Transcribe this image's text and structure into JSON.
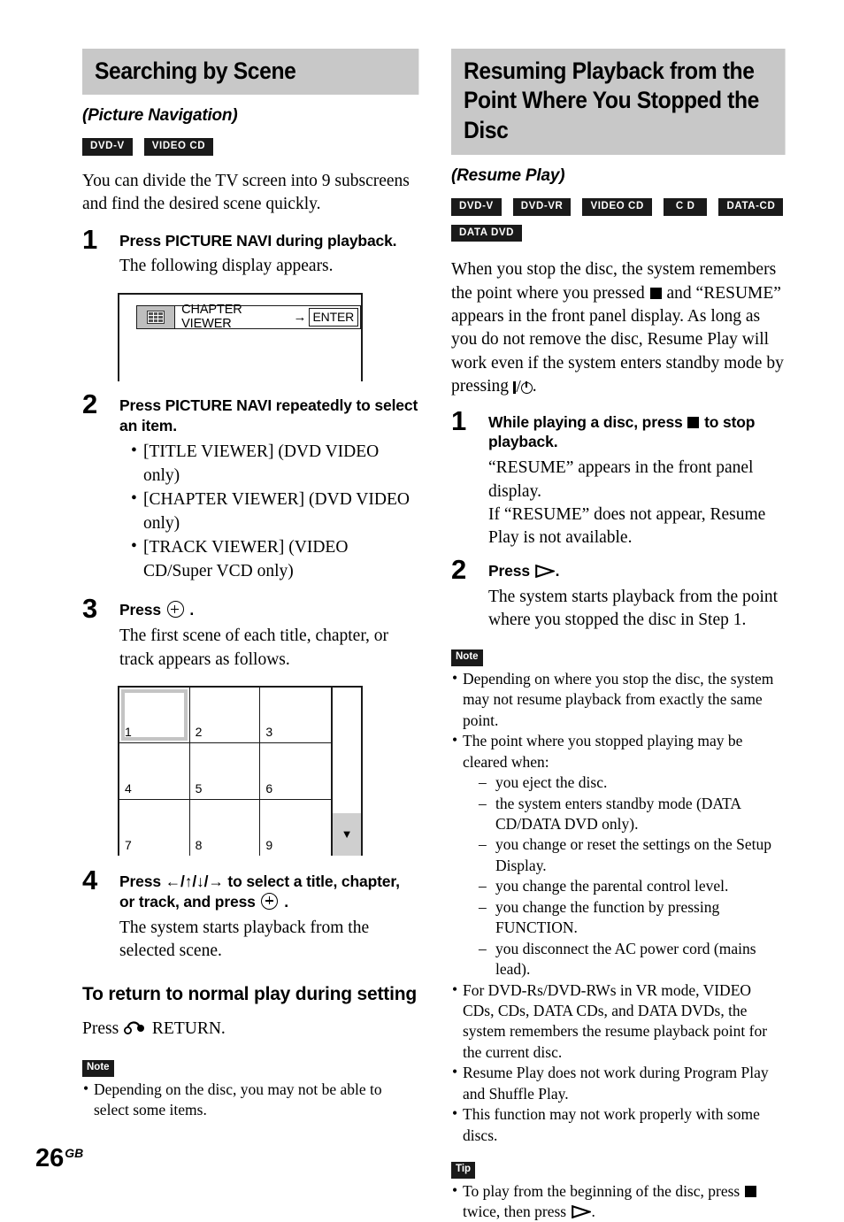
{
  "page": {
    "number": "26",
    "region_suffix": "GB"
  },
  "left_column": {
    "heading": "Searching by Scene",
    "subheading": "(Picture Navigation)",
    "badges": [
      "DVD-V",
      "VIDEO CD"
    ],
    "intro": "You can divide the TV screen into 9 subscreens and find the desired scene quickly.",
    "steps": [
      {
        "number": "1",
        "title": "Press PICTURE NAVI during playback.",
        "body": "The following display appears."
      },
      {
        "number": "2",
        "title": "Press PICTURE NAVI repeatedly to select an item.",
        "bullets": [
          "[TITLE VIEWER] (DVD VIDEO only)",
          "[CHAPTER VIEWER] (DVD VIDEO only)",
          "[TRACK VIEWER] (VIDEO CD/Super VCD only)"
        ]
      },
      {
        "number": "3",
        "title_before": "Press",
        "title_after": ".",
        "body": "The first scene of each title, chapter, or track appears as follows."
      },
      {
        "number": "4",
        "title_before": "Press",
        "title_keys": "←/↑/↓/→",
        "title_mid": "to select a title, chapter, or track, and press",
        "title_after": ".",
        "body": "The system starts playback from the selected scene."
      }
    ],
    "osd": {
      "icon_name": "chapter-viewer-icon",
      "label": "CHAPTER VIEWER",
      "arrow": "→",
      "enter_label": "ENTER"
    },
    "grid": {
      "cells": [
        "1",
        "2",
        "3",
        "4",
        "5",
        "6",
        "7",
        "8",
        "9"
      ],
      "selected_index": 0,
      "scroll_arrow": "▼"
    },
    "return_section": {
      "heading": "To return to normal play during setting",
      "text_before": "Press",
      "text_after": "RETURN."
    },
    "note": {
      "tag": "Note",
      "items": [
        "Depending on the disc, you may not be able to select some items."
      ]
    }
  },
  "right_column": {
    "heading": "Resuming Playback from the Point Where You Stopped the Disc",
    "subheading": "(Resume Play)",
    "badges": [
      "DVD-V",
      "DVD-VR",
      "VIDEO CD",
      "C D",
      "DATA-CD",
      "DATA DVD"
    ],
    "intro_part1": "When you stop the disc, the system remembers the point where you pressed",
    "intro_part2": "and “RESUME” appears in the front panel display. As long as you do not remove the disc, Resume Play will work even if the system enters standby mode by pressing",
    "intro_part3": ".",
    "steps": [
      {
        "number": "1",
        "title_before": "While playing a disc, press",
        "title_after": "to stop playback.",
        "body_lines": [
          "“RESUME” appears in the front panel display.",
          "If “RESUME” does not appear, Resume Play is not available."
        ]
      },
      {
        "number": "2",
        "title_before": "Press",
        "title_after": ".",
        "body": "The system starts playback from the point where you stopped the disc in Step 1."
      }
    ],
    "note": {
      "tag": "Note",
      "items": [
        "Depending on where you stop the disc, the system may not resume playback from exactly the same point.",
        "The point where you stopped playing may be cleared when:"
      ],
      "sub_items": [
        "you eject the disc.",
        "the system enters standby mode (DATA CD/DATA DVD only).",
        "you change or reset the settings on the Setup Display.",
        "you change the parental control level.",
        "you change the function by pressing FUNCTION.",
        "you disconnect the AC power cord (mains lead)."
      ],
      "items_after": [
        "For DVD-Rs/DVD-RWs in VR mode, VIDEO CDs, CDs, DATA CDs, and DATA DVDs, the system remembers the resume playback point for the current disc.",
        "Resume Play does not work during Program Play and Shuffle Play.",
        "This function may not work properly with some discs."
      ]
    },
    "tip": {
      "tag": "Tip",
      "text_before": "To play from the beginning of the disc, press",
      "text_mid": "twice, then press",
      "text_after": "."
    }
  },
  "colors": {
    "heading_band": "#c8c8c8",
    "badge_bg": "#1a1a1a",
    "selection_border": "#c4c4c4"
  }
}
